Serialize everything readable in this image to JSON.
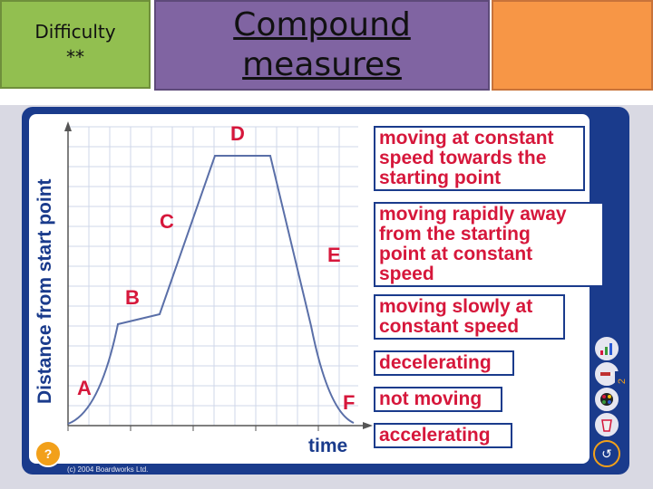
{
  "header": {
    "difficulty_label": "Difficulty",
    "difficulty_stars": "**",
    "title_line1": "Compound",
    "title_line2": "measures",
    "colors": {
      "green": "#92bf50",
      "purple": "#8064a2",
      "orange": "#f79646"
    }
  },
  "graph": {
    "y_axis_label": "Distance from start point",
    "x_axis_label": "time",
    "point_labels": [
      "A",
      "B",
      "C",
      "D",
      "E",
      "F"
    ],
    "line_color": "#5a6fa8",
    "label_color": "#d6173b"
  },
  "label_cards": [
    {
      "text_lines": [
        "moving at constant",
        "speed towards the",
        "starting point"
      ]
    },
    {
      "text_lines": [
        "moving rapidly away",
        "from the starting",
        "point at constant",
        "speed"
      ]
    },
    {
      "text_lines": [
        "moving slowly at",
        "constant speed"
      ]
    },
    {
      "text_lines": [
        "decelerating"
      ]
    },
    {
      "text_lines": [
        "not moving"
      ]
    },
    {
      "text_lines": [
        "accelerating"
      ]
    }
  ],
  "side_buttons": {
    "icons": [
      "chart-icon",
      "pen-icon",
      "palette-icon",
      "bin-icon",
      "undo-icon"
    ],
    "help_icon": "help-icon",
    "page_number": "2"
  },
  "footer": {
    "copyright": "(c) 2004 Boardworks Ltd."
  }
}
